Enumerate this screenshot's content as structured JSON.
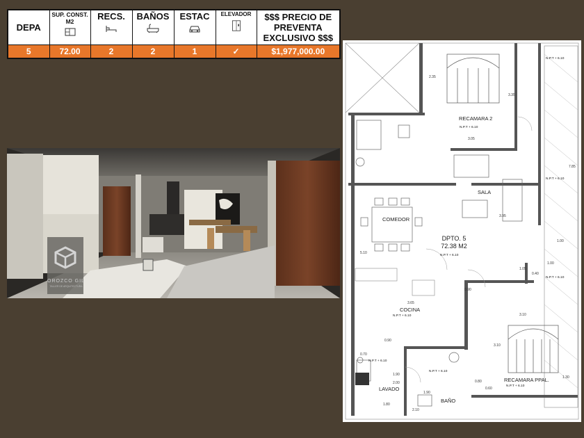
{
  "table": {
    "headers": {
      "depa": "DEPA",
      "sup_line1": "SUP. CONST.",
      "sup_line2": "M2",
      "recs": "RECS.",
      "banos": "BAÑOS",
      "estac": "ESTAC",
      "elevador": "ELEVADOR",
      "precio_line1": "$$$ PRECIO DE",
      "precio_line2": "PREVENTA",
      "precio_line3": "EXCLUSIVO $$$"
    },
    "icons": {
      "sup": "area-plan-icon",
      "recs": "bed-icon",
      "banos": "bathtub-icon",
      "estac": "car-icon",
      "elevador": "elevator-icon"
    },
    "row": {
      "depa": "5",
      "sup": "72.00",
      "recs": "2",
      "banos": "2",
      "estac": "1",
      "elevador": "✓",
      "precio": "$1,977,000.00"
    }
  },
  "render": {
    "logo_text": "OROZCO GIL",
    "logo_sub": "TALLER DE ARQUITECTURA"
  },
  "plan": {
    "unit_name": "DPTO. 5",
    "unit_area": "72.38 M2",
    "rooms": {
      "recamara2": "RECAMARA 2",
      "sala": "SALA",
      "comedor": "COMEDOR",
      "cocina": "COCINA",
      "lavado": "LAVADO",
      "bano": "BAÑO",
      "recamara_ppal": "RECAMARA PPAL."
    },
    "npt_label": "N.P.T + 6.10",
    "dims": [
      "2.35",
      "3.35",
      "3.05",
      "7.85",
      "3.95",
      "1.00",
      "1.05",
      "0.40",
      "1.00",
      "5.10",
      "0.90",
      "3.65",
      "3.10",
      "0.90",
      "3.10",
      "0.70",
      "1.90",
      "1.30",
      "2.00",
      "0.80",
      "0.60",
      "1.80",
      "2.10",
      "1.90"
    ]
  },
  "colors": {
    "background": "#4a3f31",
    "table_row": "#e8772a",
    "table_border": "#111111"
  }
}
